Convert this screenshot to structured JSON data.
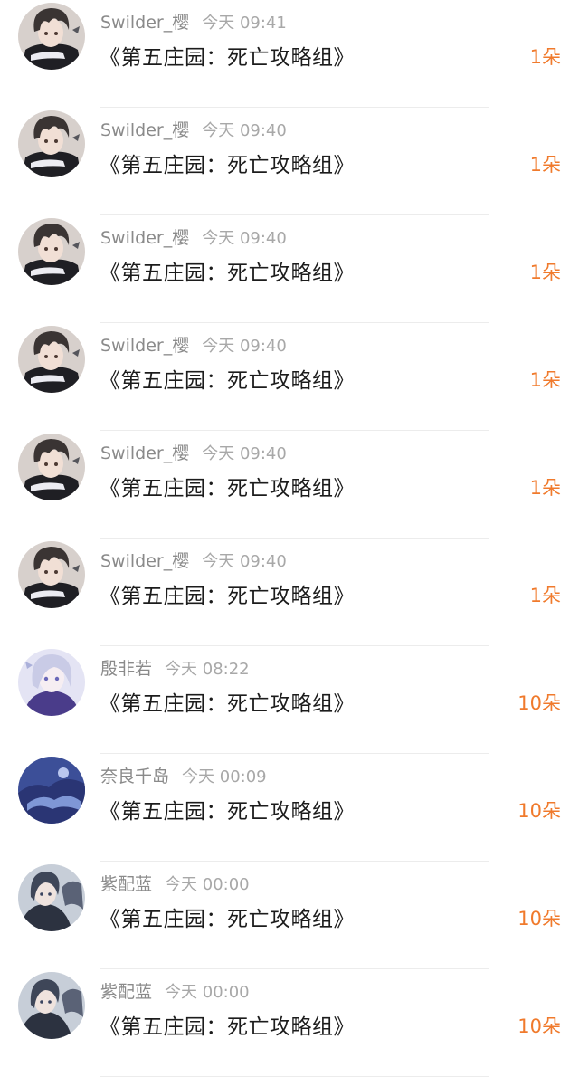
{
  "gift_list": {
    "items": [
      {
        "user": "Swilder_樱",
        "time": "今天 09:41",
        "work": "《第五庄园：死亡攻略组》",
        "gift": "1朵",
        "avatar_icon": "anime-boy-avatar"
      },
      {
        "user": "Swilder_樱",
        "time": "今天 09:40",
        "work": "《第五庄园：死亡攻略组》",
        "gift": "1朵",
        "avatar_icon": "anime-boy-avatar"
      },
      {
        "user": "Swilder_樱",
        "time": "今天 09:40",
        "work": "《第五庄园：死亡攻略组》",
        "gift": "1朵",
        "avatar_icon": "anime-boy-avatar"
      },
      {
        "user": "Swilder_樱",
        "time": "今天 09:40",
        "work": "《第五庄园：死亡攻略组》",
        "gift": "1朵",
        "avatar_icon": "anime-boy-avatar"
      },
      {
        "user": "Swilder_樱",
        "time": "今天 09:40",
        "work": "《第五庄园：死亡攻略组》",
        "gift": "1朵",
        "avatar_icon": "anime-boy-avatar"
      },
      {
        "user": "Swilder_樱",
        "time": "今天 09:40",
        "work": "《第五庄园：死亡攻略组》",
        "gift": "1朵",
        "avatar_icon": "anime-boy-avatar"
      },
      {
        "user": "殷非若",
        "time": "今天 08:22",
        "work": "《第五庄园：死亡攻略组》",
        "gift": "10朵",
        "avatar_icon": "silver-hair-girl-avatar"
      },
      {
        "user": "奈良千岛",
        "time": "今天 00:09",
        "work": "《第五庄园：死亡攻略组》",
        "gift": "10朵",
        "avatar_icon": "blue-landscape-avatar"
      },
      {
        "user": "紫配蓝",
        "time": "今天 00:00",
        "work": "《第五庄园：死亡攻略组》",
        "gift": "10朵",
        "avatar_icon": "two-characters-avatar"
      },
      {
        "user": "紫配蓝",
        "time": "今天 00:00",
        "work": "《第五庄园：死亡攻略组》",
        "gift": "10朵",
        "avatar_icon": "two-characters-avatar"
      }
    ]
  },
  "colors": {
    "gift_count": "#f07a2c",
    "username": "#8a8a8a",
    "timestamp": "#a8a8a8",
    "title_text": "#1c1c1c",
    "divider": "#ececec"
  }
}
